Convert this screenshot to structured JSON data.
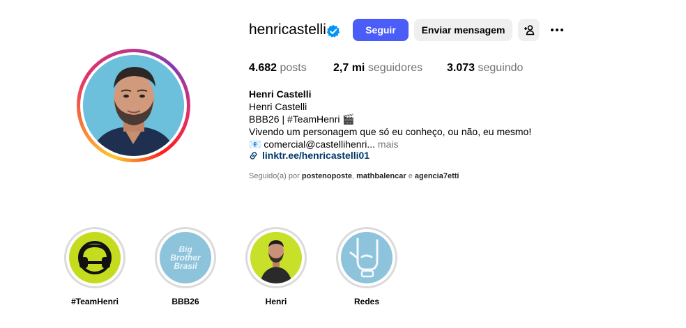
{
  "profile": {
    "username": "henricastelli",
    "follow_label": "Seguir",
    "message_label": "Enviar mensagem",
    "stats": {
      "posts_value": "4.682",
      "posts_label": "posts",
      "followers_value": "2,7 mi",
      "followers_label": "seguidores",
      "following_value": "3.073",
      "following_label": "seguindo"
    },
    "bio": {
      "name": "Henri Castelli",
      "line1": "Henri Castelli",
      "line2": "BBB26 | #TeamHenri 🎬",
      "line3": "Vivendo um personagem que só eu conheço, ou não, eu mesmo!",
      "line4": "📧 comercial@castellihenri...",
      "more_label": "mais",
      "link": "linktr.ee/henricastelli01"
    },
    "followed_by": {
      "prefix": "Seguido(a) por",
      "user1": "postenoposte",
      "sep": ",",
      "user2": "mathbalencar",
      "and": "e",
      "user3": "agencia7etti"
    }
  },
  "highlights": [
    {
      "label": "#TeamHenri"
    },
    {
      "label": "BBB26"
    },
    {
      "label": "Henri"
    },
    {
      "label": "Redes"
    }
  ],
  "highlight_art": {
    "bbb_line1": "Big",
    "bbb_line2": "Brother",
    "bbb_line3": "Brasil"
  },
  "colors": {
    "accent": "#4a5df9",
    "lime": "#c5dc1e",
    "light_blue": "#8ec3dc",
    "link": "#00376b",
    "muted": "#737373"
  },
  "icons": {
    "verified": "verified-badge-icon",
    "add_person": "add-person-icon",
    "more": "more-options-icon",
    "link": "link-icon"
  }
}
